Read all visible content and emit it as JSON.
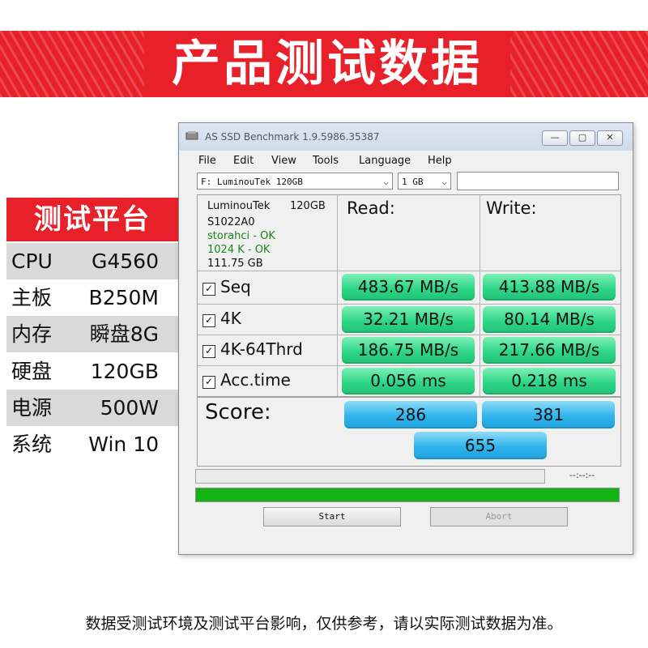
{
  "banner": {
    "title": "产品测试数据"
  },
  "specs": {
    "heading": "测试平台",
    "rows": [
      {
        "key": "CPU",
        "value": "G4560"
      },
      {
        "key": "主板",
        "value": "B250M"
      },
      {
        "key": "内存",
        "value": "瞬盘8G"
      },
      {
        "key": "硬盘",
        "value": "120GB"
      },
      {
        "key": "电源",
        "value": "500W"
      },
      {
        "key": "系统",
        "value": "Win 10"
      }
    ]
  },
  "window": {
    "title": "AS SSD Benchmark 1.9.5986.35387",
    "controls": {
      "minimize": "—",
      "maximize": "▢",
      "close": "✕"
    },
    "menu": [
      "File",
      "Edit",
      "View",
      "Tools",
      "Language",
      "Help"
    ],
    "drive_select": "F: LuminouTek   120GB",
    "size_select": "1 GB",
    "info": {
      "model": "LuminouTek",
      "capacity": "120GB",
      "firmware": "S1022A0",
      "driver": "storahci - OK",
      "alignment": "1024 K - OK",
      "size": "111.75  GB"
    },
    "columns": {
      "read": "Read:",
      "write": "Write:"
    },
    "tests": [
      {
        "label": "Seq",
        "read": "483.67 MB/s",
        "write": "413.88 MB/s"
      },
      {
        "label": "4K",
        "read": "32.21 MB/s",
        "write": "80.14 MB/s"
      },
      {
        "label": "4K-64Thrd",
        "read": "186.75 MB/s",
        "write": "217.66 MB/s"
      },
      {
        "label": "Acc.time",
        "read": "0.056 ms",
        "write": "0.218 ms"
      }
    ],
    "score": {
      "label": "Score:",
      "read": "286",
      "write": "381",
      "total": "655"
    },
    "timer": "--:--:--",
    "progress": 1.0,
    "buttons": {
      "start": "Start",
      "abort": "Abort"
    },
    "checkmark": "☑"
  },
  "footer": {
    "note": "数据受测试环境及测试平台影响，仅供参考，请以实际测试数据为准。"
  },
  "colors": {
    "brand_red": "#e8202a",
    "result_green": "#2fd687",
    "score_blue": "#2fb4ec",
    "progress_green": "#13b313"
  }
}
